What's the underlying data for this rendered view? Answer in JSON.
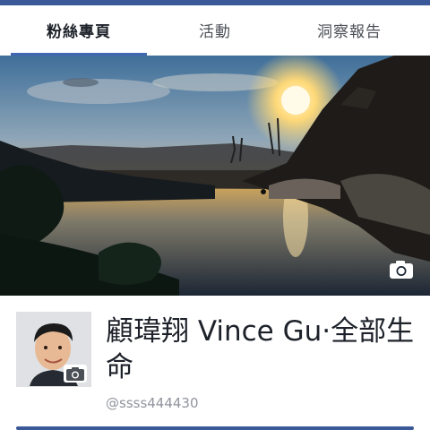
{
  "tabs": [
    {
      "label": "粉絲專頁",
      "active": true
    },
    {
      "label": "活動",
      "active": false
    },
    {
      "label": "洞察報告",
      "active": false
    }
  ],
  "cover": {
    "camera_icon": "camera-icon"
  },
  "profile": {
    "name": "顧瑋翔 Vince Gu·全部生命",
    "handle": "@ssss444430",
    "avatar_camera_icon": "camera-icon"
  },
  "colors": {
    "brand": "#3b5998",
    "tab_underline": "#4267b2",
    "handle_text": "#90949c"
  }
}
